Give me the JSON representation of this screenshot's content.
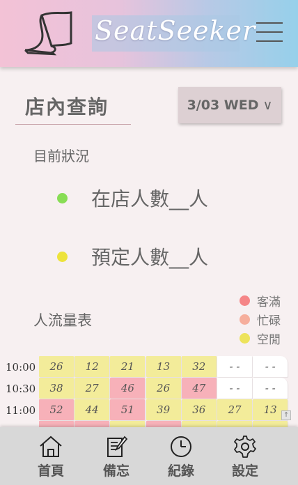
{
  "app": {
    "brand": "SeatSeeker"
  },
  "colors": {
    "full": "#f7b1b9",
    "busy": "#f4b6a4",
    "free": "#f3ec9a",
    "empty": "#ffffff",
    "legend_full": "#f58587",
    "legend_busy": "#f6ae9c",
    "legend_free": "#ede35b",
    "dot_green": "#88dd55",
    "dot_yellow": "#ede33b"
  },
  "page": {
    "title": "店內查詢",
    "date": "3/03 WED",
    "date_chevron": "∨"
  },
  "current_status": {
    "label": "目前狀況",
    "in_store": "在店人數__人",
    "reserved": "預定人數__人"
  },
  "flow_chart": {
    "label": "人流量表",
    "legend": [
      {
        "label": "客滿",
        "status": "full"
      },
      {
        "label": "忙碌",
        "status": "busy"
      },
      {
        "label": "空閒",
        "status": "free"
      }
    ],
    "rows": [
      {
        "time": "10:00",
        "cells": [
          {
            "v": "26",
            "s": "free"
          },
          {
            "v": "12",
            "s": "free"
          },
          {
            "v": "21",
            "s": "free"
          },
          {
            "v": "13",
            "s": "free"
          },
          {
            "v": "32",
            "s": "free"
          },
          {
            "v": "- -",
            "s": "empty"
          },
          {
            "v": "- -",
            "s": "empty"
          }
        ]
      },
      {
        "time": "10:30",
        "cells": [
          {
            "v": "38",
            "s": "free"
          },
          {
            "v": "27",
            "s": "free"
          },
          {
            "v": "46",
            "s": "full"
          },
          {
            "v": "26",
            "s": "free"
          },
          {
            "v": "47",
            "s": "full"
          },
          {
            "v": "- -",
            "s": "empty"
          },
          {
            "v": "- -",
            "s": "empty"
          }
        ]
      },
      {
        "time": "11:00",
        "cells": [
          {
            "v": "52",
            "s": "full"
          },
          {
            "v": "44",
            "s": "free"
          },
          {
            "v": "51",
            "s": "full"
          },
          {
            "v": "39",
            "s": "free"
          },
          {
            "v": "36",
            "s": "free"
          },
          {
            "v": "27",
            "s": "free"
          },
          {
            "v": "13",
            "s": "free"
          }
        ]
      },
      {
        "time": "",
        "cells": [
          {
            "v": "",
            "s": "full"
          },
          {
            "v": "",
            "s": "full"
          },
          {
            "v": "",
            "s": "free"
          },
          {
            "v": "",
            "s": "full"
          },
          {
            "v": "",
            "s": "free"
          },
          {
            "v": "",
            "s": "free"
          },
          {
            "v": "",
            "s": "free"
          }
        ]
      }
    ]
  },
  "nav": [
    {
      "label": "首頁",
      "icon": "home-icon"
    },
    {
      "label": "備忘",
      "icon": "memo-icon"
    },
    {
      "label": "紀錄",
      "icon": "clock-icon"
    },
    {
      "label": "設定",
      "icon": "gear-icon"
    }
  ]
}
